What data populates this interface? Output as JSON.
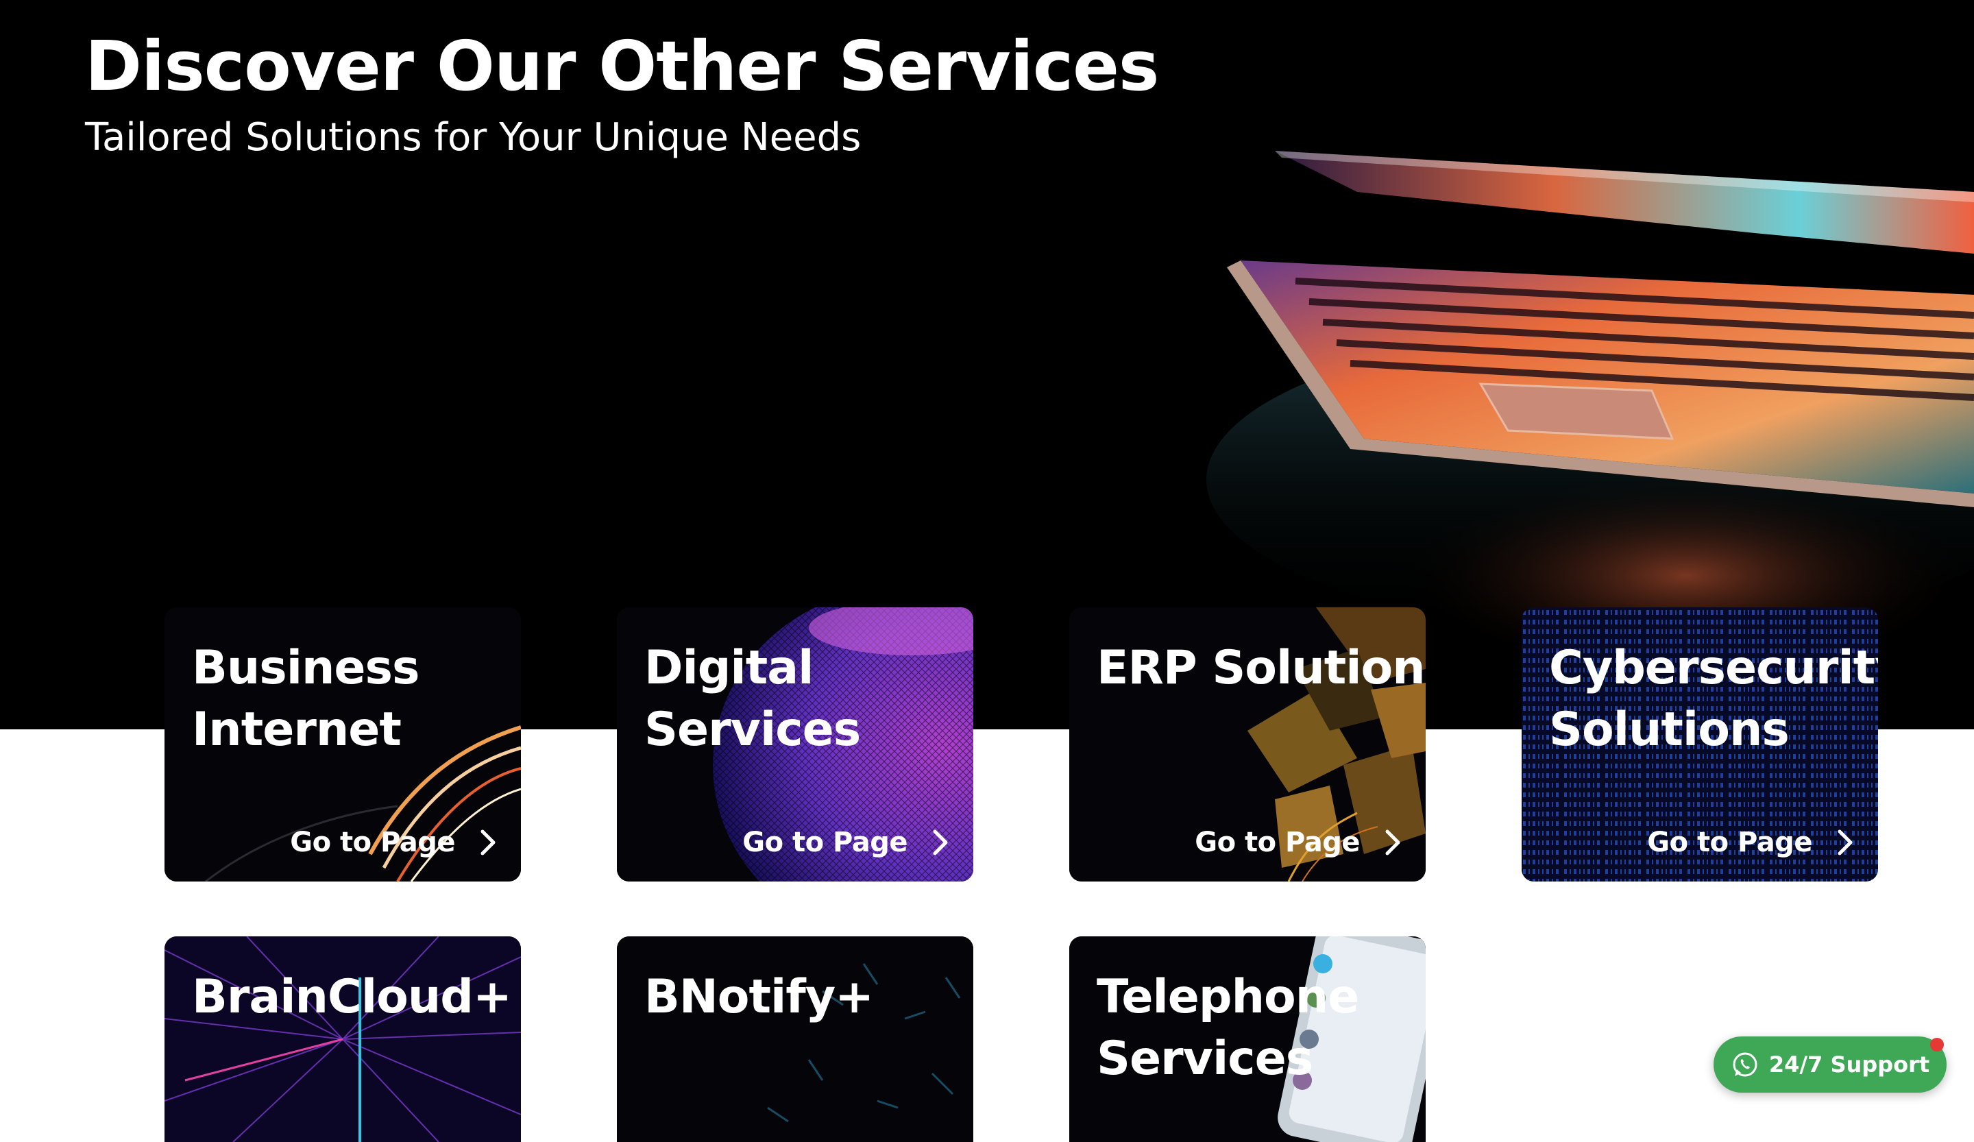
{
  "hero": {
    "title": "Discover Our Other Services",
    "subtitle": "Tailored Solutions for Your Unique Needs"
  },
  "cards": [
    {
      "title_line1": "Business",
      "title_line2": "Internet",
      "link": "Go to Page"
    },
    {
      "title_line1": "Digital",
      "title_line2": "Services",
      "link": "Go to Page"
    },
    {
      "title_line1": "ERP Solutions",
      "title_line2": "",
      "link": "Go to Page"
    },
    {
      "title_line1": "Cybersecurity",
      "title_line2": "Solutions",
      "link": "Go to Page"
    },
    {
      "title_line1": "BrainCloud+",
      "title_line2": ""
    },
    {
      "title_line1": "BNotify+",
      "title_line2": ""
    },
    {
      "title_line1": "Telephone",
      "title_line2": "Services"
    }
  ],
  "support": {
    "label": "24/7 Support",
    "icon": "whatsapp-icon"
  },
  "colors": {
    "hero_bg": "#000000",
    "support_green": "#3fa857",
    "notify_red": "#e53935",
    "card_text": "#ffffff"
  }
}
